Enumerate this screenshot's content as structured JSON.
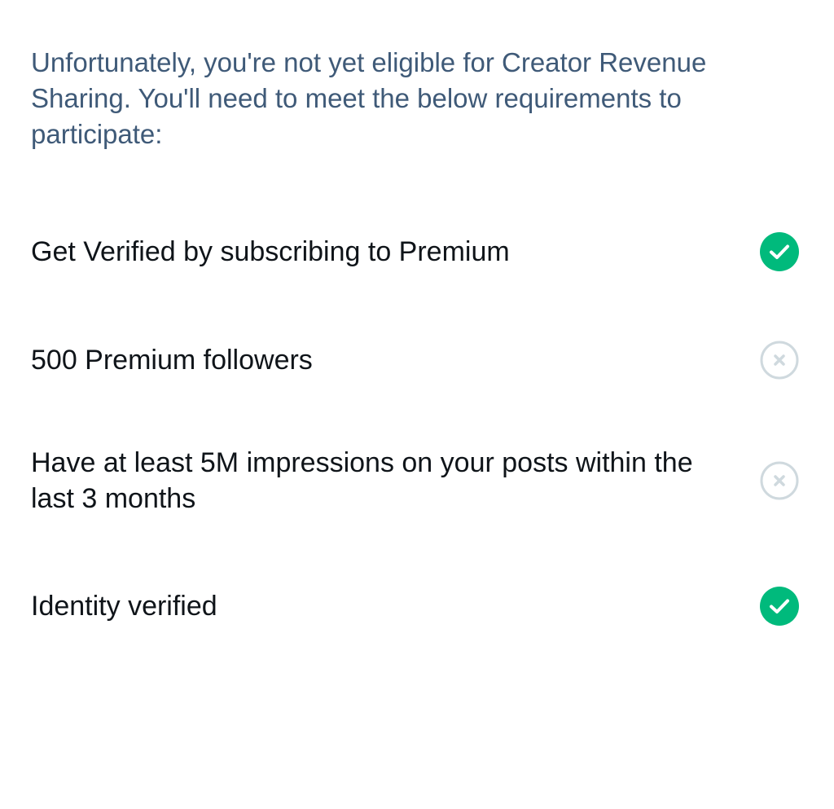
{
  "intro_text": "Unfortunately, you're not yet eligible for Creator Revenue Sharing. You'll need to meet the below requirements to participate:",
  "colors": {
    "intro_text": "#3f5a78",
    "item_text": "#0f1419",
    "met": "#00ba7c",
    "not_met": "#cfd9de"
  },
  "requirements": [
    {
      "label": "Get Verified by subscribing to Premium",
      "status": "met",
      "icon": "check-circle-icon"
    },
    {
      "label": "500 Premium followers",
      "status": "not_met",
      "icon": "x-circle-icon"
    },
    {
      "label": "Have at least 5M impressions on your posts within the last 3 months",
      "status": "not_met",
      "icon": "x-circle-icon"
    },
    {
      "label": "Identity verified",
      "status": "met",
      "icon": "check-circle-icon"
    }
  ]
}
